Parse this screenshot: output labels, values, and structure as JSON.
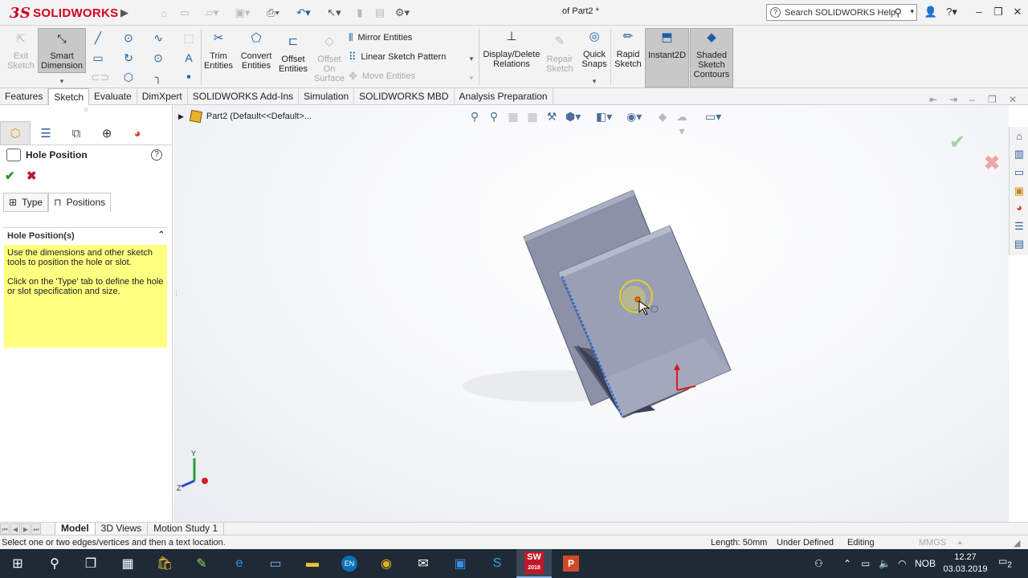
{
  "app": {
    "brand": "SOLIDWORKS",
    "window_title": "of Part2 *"
  },
  "search": {
    "placeholder": "Search SOLIDWORKS Help"
  },
  "ribbon": {
    "exit_sketch": "Exit Sketch",
    "smart_dimension": "Smart Dimension",
    "trim_entities": "Trim Entities",
    "convert_entities": "Convert Entities",
    "offset_entities": "Offset Entities",
    "offset_on_surface": "Offset On Surface",
    "mirror_entities": "Mirror Entities",
    "linear_sketch_pattern": "Linear Sketch Pattern",
    "move_entities": "Move Entities",
    "display_delete_relations": "Display/Delete Relations",
    "repair_sketch": "Repair Sketch",
    "quick_snaps": "Quick Snaps",
    "rapid_sketch": "Rapid Sketch",
    "instant2d": "Instant2D",
    "shaded_sketch_contours": "Shaded Sketch Contours"
  },
  "tabs": [
    "Features",
    "Sketch",
    "Evaluate",
    "DimXpert",
    "SOLIDWORKS Add-Ins",
    "Simulation",
    "SOLIDWORKS MBD",
    "Analysis Preparation"
  ],
  "active_tab": "Sketch",
  "property_manager": {
    "title": "Hole Position",
    "subtabs": {
      "type": "Type",
      "positions": "Positions"
    },
    "group_title": "Hole Position(s)",
    "message_1": "Use the dimensions and other sketch tools to position the hole or slot.",
    "message_2": "Click on the 'Type' tab to define the hole or slot specification and size."
  },
  "feature_tree": {
    "root": "Part2  (Default<<Default>..."
  },
  "triad": {
    "y": "Y",
    "z": "Z"
  },
  "bottom_tabs": [
    "Model",
    "3D Views",
    "Motion Study 1"
  ],
  "active_bottom_tab": "Model",
  "status": {
    "prompt": "Select one or two edges/vertices and then a text location.",
    "length": "Length: 50mm",
    "state": "Under Defined",
    "mode": "Editing",
    "units": "MMGS"
  },
  "taskbar": {
    "sw_badge": "2018",
    "lang_icon": "EN",
    "tray_lang": "NOB",
    "time": "12.27",
    "date": "03.03.2019",
    "notifications": "2"
  },
  "colors": {
    "accent_blue": "#1b5ea8",
    "brand_red": "#d0021b",
    "note_yellow": "#ffff80",
    "model_face": "#8e93ac",
    "taskbar": "#1f2a36"
  }
}
